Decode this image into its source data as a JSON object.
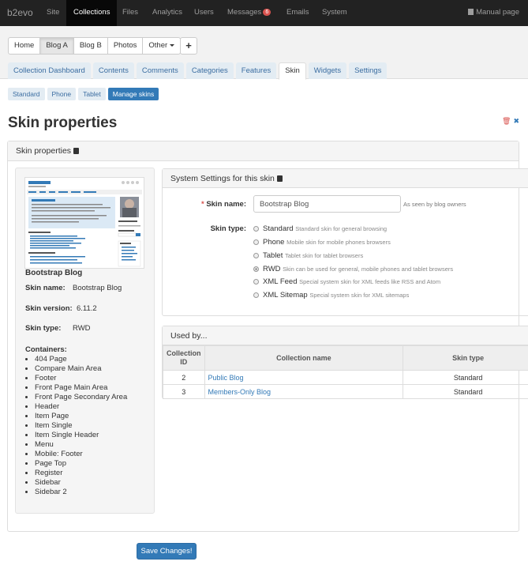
{
  "topnav": {
    "brand": "b2evo",
    "items": [
      {
        "label": "Site"
      },
      {
        "label": "Collections"
      },
      {
        "label": "Files"
      },
      {
        "label": "Analytics"
      },
      {
        "label": "Users"
      },
      {
        "label": "Messages",
        "badge": "6"
      },
      {
        "label": "Emails"
      },
      {
        "label": "System"
      }
    ],
    "manual": "Manual page"
  },
  "collections": [
    "Home",
    "Blog A",
    "Blog B",
    "Photos",
    "Other"
  ],
  "add_button": "+",
  "tabs": [
    "Collection Dashboard",
    "Contents",
    "Comments",
    "Categories",
    "Features",
    "Skin",
    "Widgets",
    "Settings"
  ],
  "subtabs": [
    "Standard",
    "Phone",
    "Tablet",
    "Manage skins"
  ],
  "page_title": "Skin properties",
  "panel_title": "Skin properties",
  "skin": {
    "name_heading": "Bootstrap Blog",
    "name_label": "Skin name:",
    "name_value": "Bootstrap Blog",
    "version_label": "Skin version:",
    "version_value": "6.11.2",
    "type_label": "Skin type:",
    "type_value": "RWD",
    "containers_label": "Containers:",
    "containers": [
      "404 Page",
      "Compare Main Area",
      "Footer",
      "Front Page Main Area",
      "Front Page Secondary Area",
      "Header",
      "Item Page",
      "Item Single",
      "Item Single Header",
      "Menu",
      "Mobile: Footer",
      "Page Top",
      "Register",
      "Sidebar",
      "Sidebar 2"
    ]
  },
  "system_settings": {
    "title": "System Settings for this skin",
    "skin_name_label": "Skin name:",
    "skin_name_value": "Bootstrap Blog",
    "skin_name_hint": "As seen by blog owners",
    "skin_type_label": "Skin type:",
    "types": [
      {
        "label": "Standard",
        "note": "Standard skin for general browsing",
        "checked": false
      },
      {
        "label": "Phone",
        "note": "Mobile skin for mobile phones browsers",
        "checked": false
      },
      {
        "label": "Tablet",
        "note": "Tablet skin for tablet browsers",
        "checked": false
      },
      {
        "label": "RWD",
        "note": "Skin can be used for general, mobile phones and tablet browsers",
        "checked": true
      },
      {
        "label": "XML Feed",
        "note": "Special system skin for XML feeds like RSS and Atom",
        "checked": false
      },
      {
        "label": "XML Sitemap",
        "note": "Special system skin for XML sitemaps",
        "checked": false
      }
    ]
  },
  "used_by": {
    "title": "Used by...",
    "headers": [
      "Collection ID",
      "Collection name",
      "Skin type"
    ],
    "rows": [
      {
        "id": "2",
        "name": "Public Blog",
        "type": "Standard"
      },
      {
        "id": "3",
        "name": "Members-Only Blog",
        "type": "Standard"
      }
    ]
  },
  "save_label": "Save Changes!"
}
